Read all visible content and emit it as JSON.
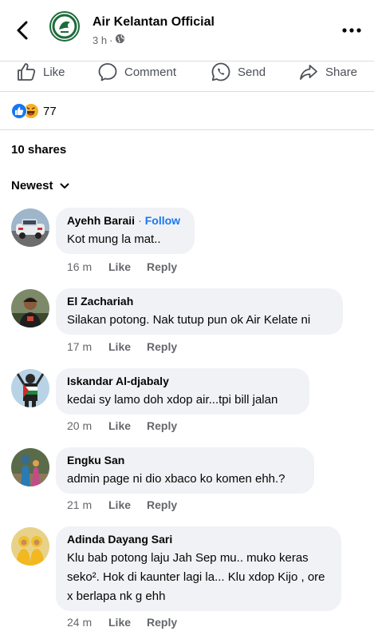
{
  "header": {
    "page_name": "Air Kelantan Official",
    "time": "3 h",
    "separator": "·"
  },
  "actions": {
    "like": "Like",
    "comment": "Comment",
    "send": "Send",
    "share": "Share"
  },
  "reactions": {
    "count": "77"
  },
  "shares": "10 shares",
  "sort": "Newest",
  "comments": [
    {
      "name": "Ayehh Baraii",
      "separator": "·",
      "follow": "Follow",
      "text": "Kot mung la mat..",
      "time": "16 m",
      "like": "Like",
      "reply": "Reply"
    },
    {
      "name": "El Zachariah",
      "text": "Silakan potong. Nak tutup pun ok Air Kelate ni",
      "time": "17 m",
      "like": "Like",
      "reply": "Reply"
    },
    {
      "name": "Iskandar Al-djabaly",
      "text": "kedai sy lamo doh xdop air...tpi bill jalan",
      "time": "20 m",
      "like": "Like",
      "reply": "Reply"
    },
    {
      "name": "Engku San",
      "text": "admin page ni dio xbaco ko komen ehh.?",
      "time": "21 m",
      "like": "Like",
      "reply": "Reply"
    },
    {
      "name": "Adinda Dayang Sari",
      "text": "Klu bab potong laju Jah Sep mu.. muko keras seko². Hok di kaunter lagi la... Klu xdop Kijo , ore x berlapa nk g ehh",
      "time": "24 m",
      "like": "Like",
      "reply": "Reply"
    }
  ]
}
